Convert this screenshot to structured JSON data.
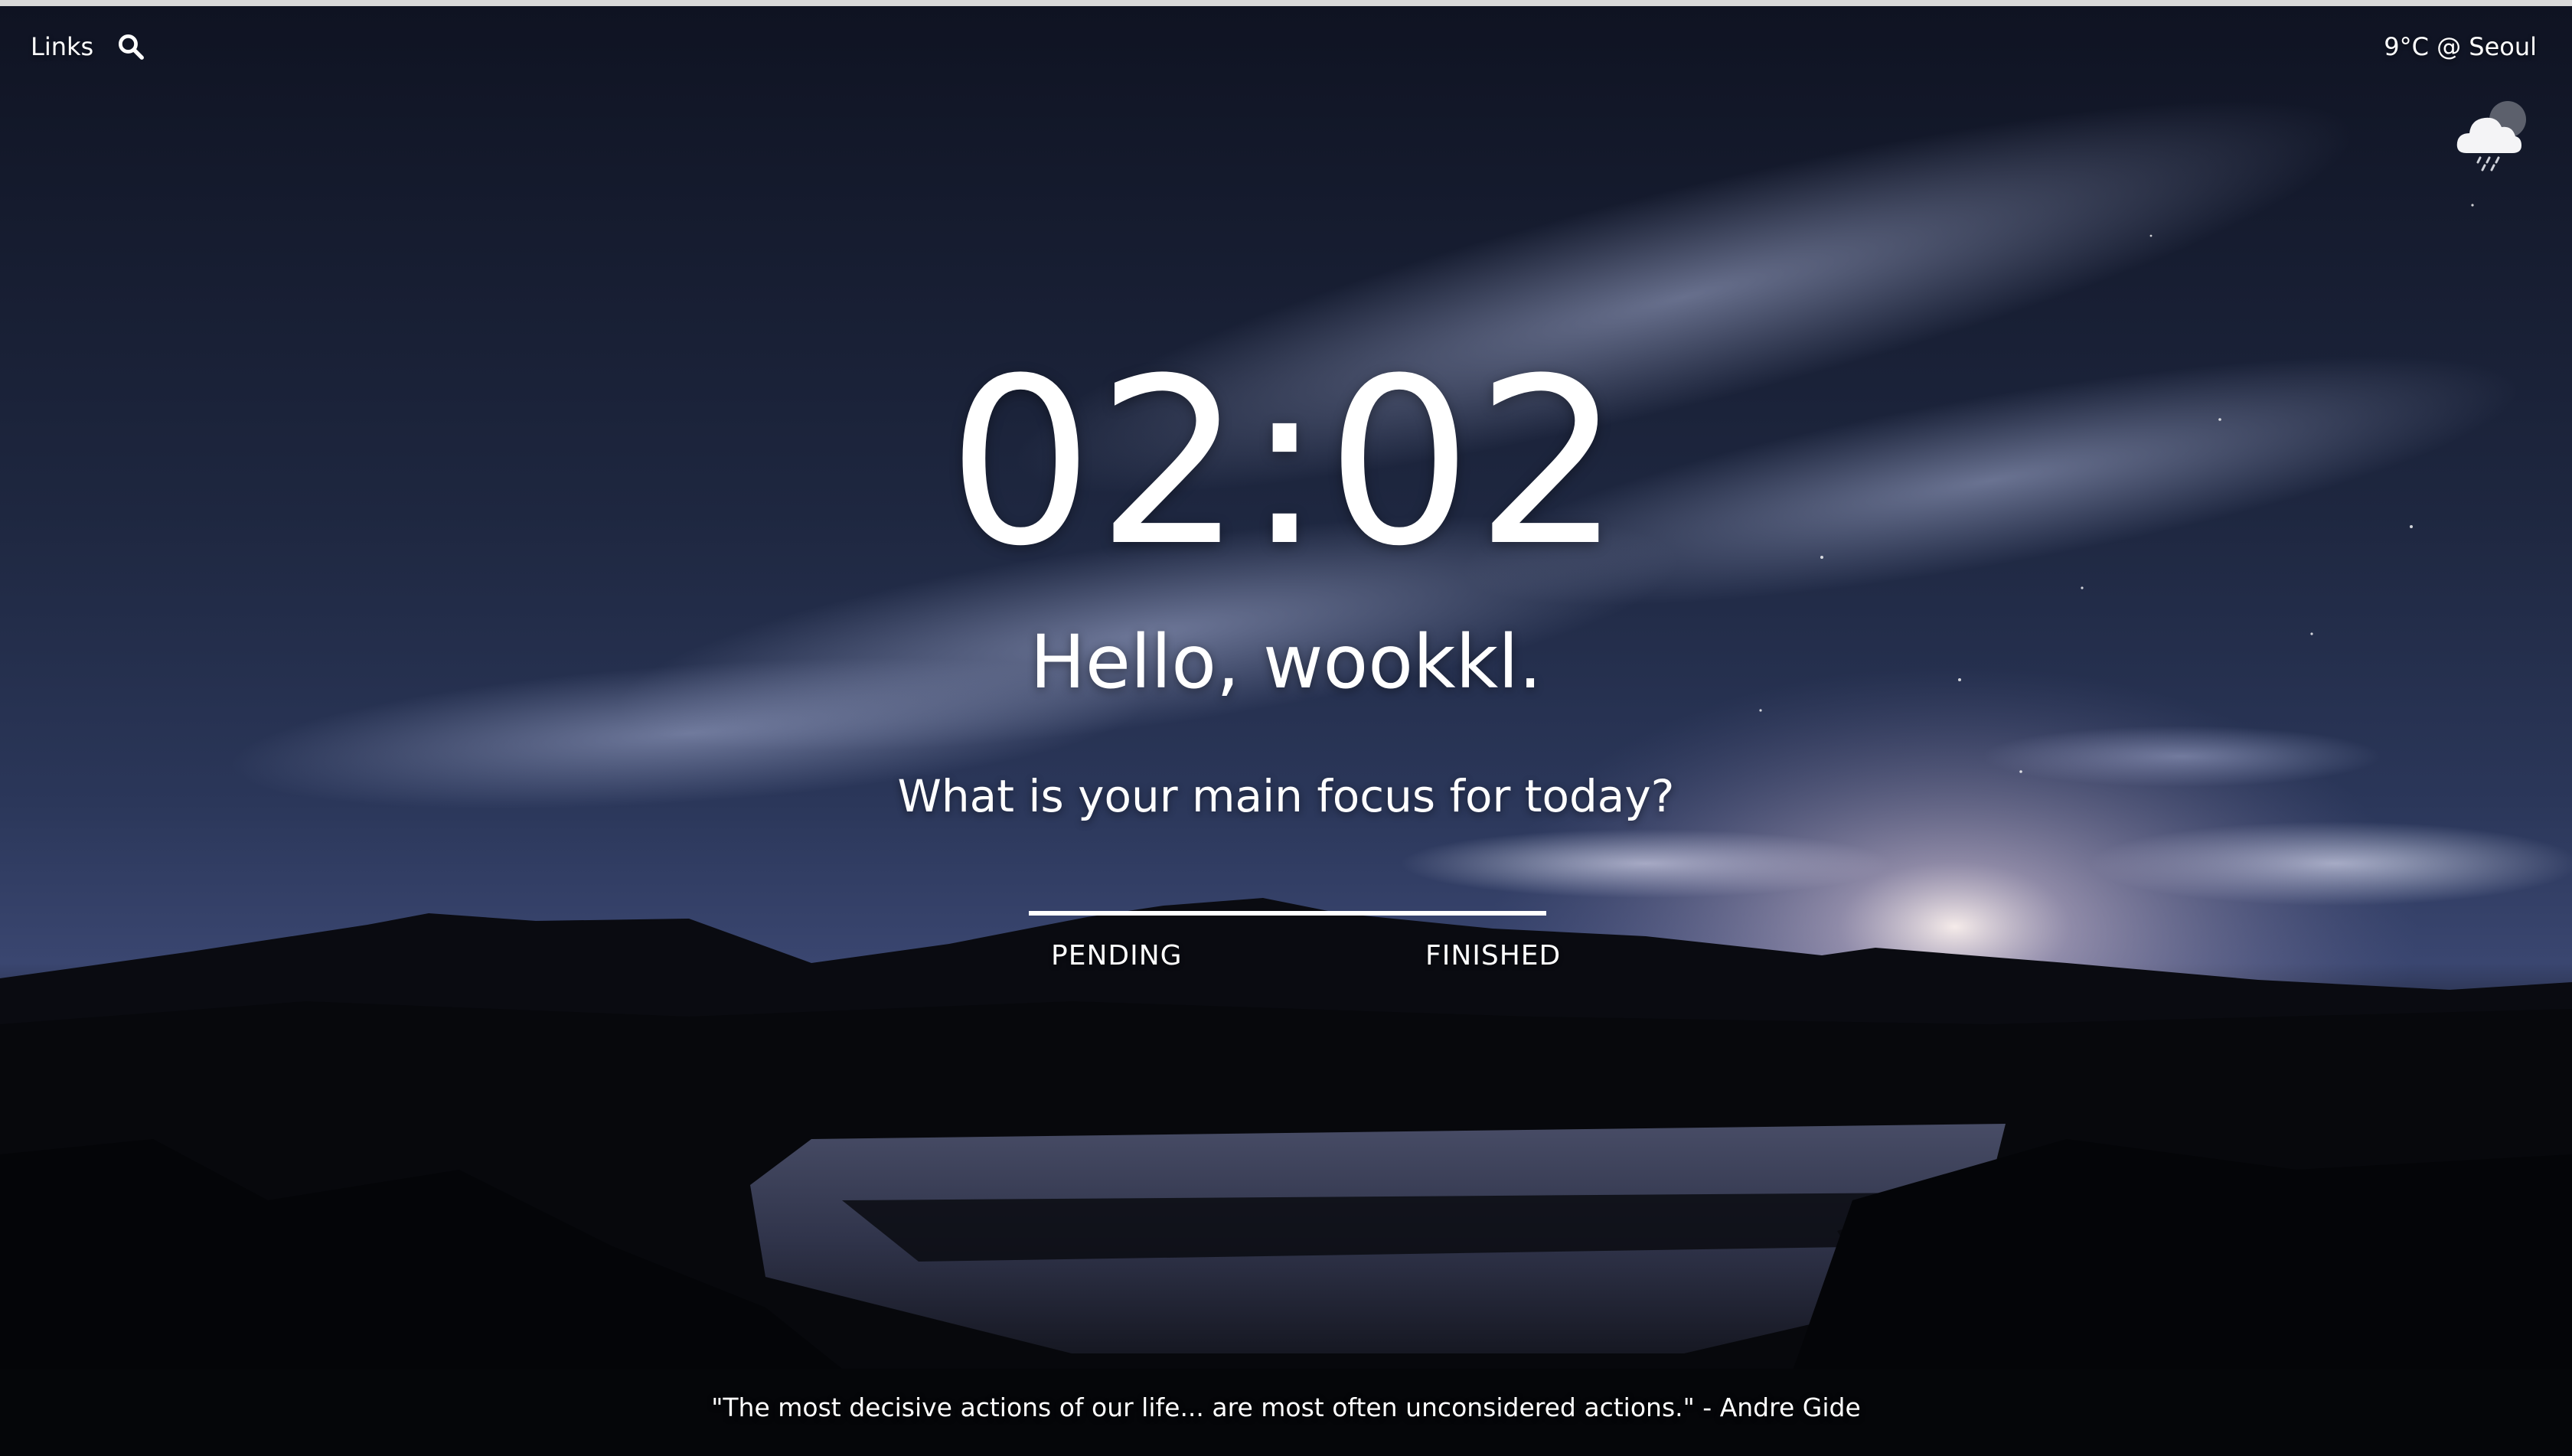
{
  "header": {
    "links_label": "Links",
    "search_icon": "search-icon"
  },
  "weather": {
    "text": "9°C @ Seoul",
    "icon": "cloud-rain-night-icon"
  },
  "clock": {
    "time": "02:02"
  },
  "greeting": {
    "text": "Hello, wookkl."
  },
  "focus": {
    "question": "What is your main focus for today?",
    "input_value": "",
    "placeholder": ""
  },
  "todo_tabs": {
    "pending_label": "PENDING",
    "finished_label": "FINISHED"
  },
  "quote": {
    "text": "\"The most decisive actions of our life... are most often unconsidered actions.\" - Andre Gide"
  },
  "colors": {
    "text": "#ffffff",
    "sky_top": "#0e1220",
    "sky_mid": "#2a3556",
    "horizon_glow": "#d9c9d8",
    "ground": "#07080c"
  }
}
